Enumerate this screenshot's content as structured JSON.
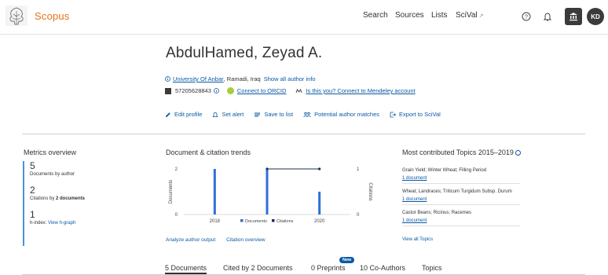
{
  "header": {
    "brand": "Scopus",
    "nav": {
      "search": "Search",
      "sources": "Sources",
      "lists": "Lists",
      "scival": "SciVal",
      "scival_ext": "↗"
    },
    "avatar_initials": "KD",
    "icons": [
      "elsevier-tree-logo",
      "help-icon",
      "bell-icon",
      "institution-icon"
    ]
  },
  "author": {
    "name": "AbdulHamed, Zeyad A.",
    "affiliation": "University Of Anbar",
    "location": ", Ramadi, Iraq",
    "show_all_info": "Show all author info",
    "scopus_id": "57205628843",
    "connect_orcid": "Connect to ORCID",
    "is_this_you": "Is this you? Connect to Mendeley account"
  },
  "actions": {
    "edit_profile": "Edit profile",
    "set_alert": "Set alert",
    "save_to_list": "Save to list",
    "potential_matches": "Potential author matches",
    "export_scival": "Export to SciVal"
  },
  "metrics": {
    "title": "Metrics overview",
    "documents_value": "5",
    "documents_label": "Documents by author",
    "citations_value": "2",
    "citations_label_pre": "Citations by ",
    "citations_label_bold": "2 documents",
    "hindex_value": "1",
    "hindex_label": "h-index:",
    "hindex_link": "View h-graph"
  },
  "trends": {
    "title": "Document & citation trends",
    "analyze_link": "Analyze author output",
    "citation_overview_link": "Citation overview"
  },
  "chart_data": {
    "type": "bar",
    "x": [
      2018,
      2019,
      2020
    ],
    "series": [
      {
        "name": "Documents",
        "type": "bar",
        "axis": "left",
        "color": "#2f6fd6",
        "values": [
          2,
          2,
          1
        ]
      },
      {
        "name": "Citations",
        "type": "line",
        "axis": "right",
        "color": "#1e2c5a",
        "values": [
          null,
          1,
          1
        ]
      }
    ],
    "xticks": [
      "2018",
      "2020"
    ],
    "ylabel_left": "Documents",
    "ylabel_right": "Citations",
    "ylim_left": [
      0,
      2
    ],
    "ylim_right": [
      0,
      1
    ],
    "legend": "bottom"
  },
  "topics": {
    "title": "Most contributed Topics 2015–2019",
    "items": [
      {
        "name": "Grain Yield; Winter Wheat; Filling Period",
        "count": "1 document"
      },
      {
        "name": "Wheat; Landraces; Triticum Turgidum Subsp. Durum",
        "count": "1 document"
      },
      {
        "name": "Castor Beans; Ricinus; Racemes",
        "count": "1 document"
      }
    ],
    "view_all": "View all Topics"
  },
  "tabs": {
    "documents": "5 Documents",
    "cited_by": "Cited by 2 Documents",
    "preprints": "0 Preprints",
    "new_badge": "New",
    "coauthors": "10 Co-Authors",
    "topics": "Topics"
  }
}
